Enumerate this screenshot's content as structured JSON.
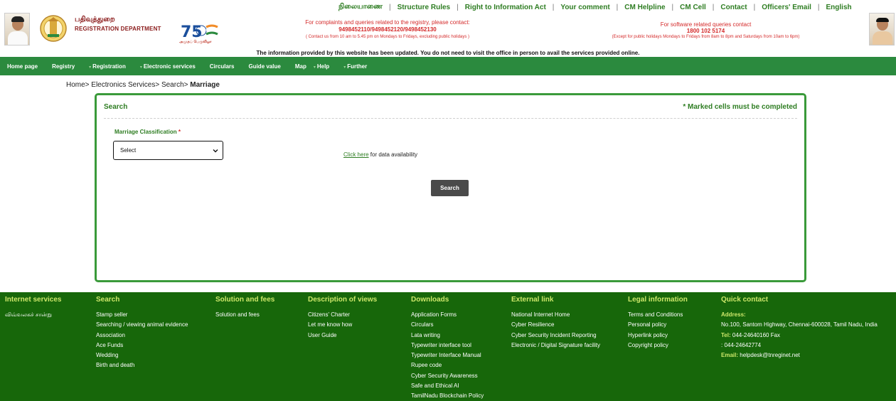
{
  "header": {
    "dept_tamil": "பதிவுத்துறை",
    "dept_english": "REGISTRATION DEPARTMENT",
    "logo75_caption": "அமுதப் பெருவிழா",
    "top_nav": [
      "நிலையாணை",
      "Structure Rules",
      "Right to Information Act",
      "Your comment",
      "CM Helpline",
      "CM Cell",
      "Contact",
      "Officers' Email",
      "English"
    ],
    "registry_contact": {
      "line1": "For complaints and queries related to the registry, please contact:",
      "line2": "9498452110/9498452120/9498452130",
      "line3": "( Contact us from 10 am to 5.45 pm on Mondays to Fridays, excluding public holidays )"
    },
    "software_contact": {
      "line1": "For software related queries contact",
      "line2": "1800 102 5174",
      "line3": "(Except for public holidays Mondays to Fridays from 8am to 8pm and Saturdays from 10am to 6pm)"
    },
    "notice": "The information provided by this website has been updated. You do not need to visit the office in person to avail the services provided online."
  },
  "main_nav": [
    {
      "label": "Home page",
      "dropdown": false
    },
    {
      "label": "Registry",
      "dropdown": false
    },
    {
      "label": "Registration",
      "dropdown": true
    },
    {
      "label": "Electronic services",
      "dropdown": true
    },
    {
      "label": "Circulars",
      "dropdown": false
    },
    {
      "label": "Guide value",
      "dropdown": false
    },
    {
      "label": "Map",
      "dropdown": false
    },
    {
      "label": "Help",
      "dropdown": true
    },
    {
      "label": "Further",
      "dropdown": true
    }
  ],
  "breadcrumb": {
    "trail": "Home> Electronics Services> Search> ",
    "current": "Marriage"
  },
  "panel": {
    "title": "Search",
    "required_note": "* Marked cells must be completed",
    "field_label": "Marriage Classification",
    "required_star": "*",
    "select_value": "Select",
    "click_here": "Click here",
    "availability_text": " for data availability",
    "search_button": "Search"
  },
  "footer": {
    "columns": [
      {
        "heading": "Internet services",
        "items": [
          "விவ்வலகச் சான்று"
        ]
      },
      {
        "heading": "Search",
        "items": [
          "Stamp seller",
          "Searching / viewing animal evidence",
          "Association",
          "Ace Funds",
          "Wedding",
          "Birth and death"
        ]
      },
      {
        "heading": "Solution and fees",
        "items": [
          "Solution and fees"
        ]
      },
      {
        "heading": "Description of views",
        "items": [
          "Citizens' Charter",
          "Let me know how",
          "User Guide"
        ]
      },
      {
        "heading": "Downloads",
        "items": [
          "Application Forms",
          "Circulars",
          "Lata writing",
          "Typewriter interface tool",
          "Typewriter Interface Manual",
          "Rupee code",
          "Cyber Security Awareness",
          "Safe and Ethical AI",
          "TamilNadu Blockchain Policy"
        ]
      },
      {
        "heading": "External link",
        "items": [
          "National Internet Home",
          "Cyber Resilience",
          "Cyber Security Incident Reporting",
          "Electronic / Digital Signature facility"
        ]
      },
      {
        "heading": "Legal information",
        "items": [
          "Terms and Conditions",
          "Personal policy",
          "Hyperlink policy",
          "Copyright policy"
        ]
      }
    ],
    "quick_contact": {
      "heading": "Quick contact",
      "address_label": "Address:",
      "address": "No.100, Santom Highway, Chennai-600028, Tamil Nadu, India",
      "tel_label": "Tel:",
      "tel": " 044-24640160 Fax",
      "fax": ": 044-24642774",
      "email_label": "Email:",
      "email": " helpdesk@tnreginet.net"
    }
  },
  "colors": {
    "nav_green": "#2b8a3e",
    "footer_green": "#17670a",
    "heading_green": "#2e7d22",
    "footer_heading": "#cde86a",
    "alert_red": "#d42a2a"
  }
}
